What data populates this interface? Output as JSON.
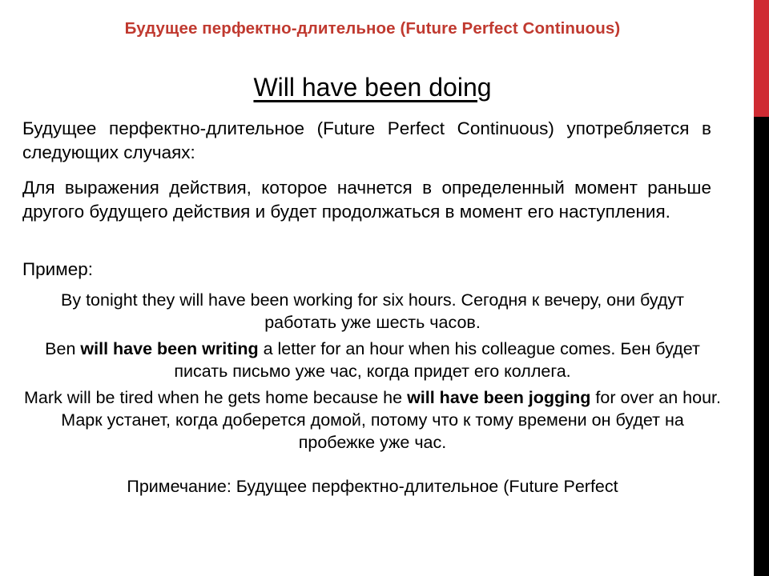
{
  "slide": {
    "title": "Будущее перфектно-длительное (Future Perfect Continuous)",
    "heading": "Will have been doing ",
    "intro_paragraph_1": "Будущее перфектно-длительное (Future Perfect Continuous) употребляется в следующих случаях:",
    "intro_paragraph_2": "Для выражения действия, которое начнется в определенный момент раньше другого будущего действия и будет продолжаться в момент его наступления.",
    "example_label": "Пример:",
    "examples": [
      {
        "id": "example-1",
        "pre_bold": "By tonight they will have been working for six hours. Сегодня к вечеру, они будут работать уже шесть часов.",
        "bold": "",
        "post_bold": ""
      },
      {
        "id": "example-2",
        "pre_bold": "Ben ",
        "bold": "will have been writing",
        "post_bold": " a letter for an hour when his colleague comes. Бен будет писать письмо уже час, когда придет его коллега."
      },
      {
        "id": "example-3",
        "pre_bold": "Mark will be tired when he gets home because he ",
        "bold": "will have been jogging",
        "post_bold": " for over an hour. Марк устанет, когда доберется домой, потому что к тому времени он будет на пробежке уже час."
      }
    ],
    "note": "Примечание: Будущее перфектно-длительное (Future Perfect"
  },
  "decoration": {
    "red_bar_color": "#cf2b33",
    "black_bar_color": "#000000",
    "title_color": "#c0392f"
  }
}
